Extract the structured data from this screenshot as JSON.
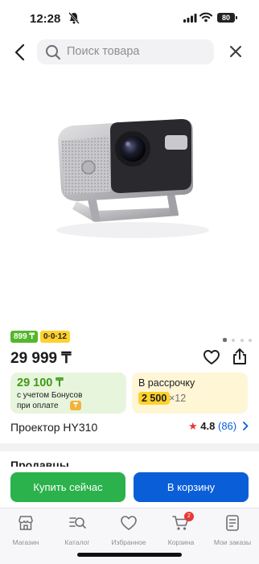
{
  "status_bar": {
    "time": "12:28",
    "battery": "80"
  },
  "search": {
    "placeholder": "Поиск товара"
  },
  "product": {
    "badge_price": "899 ₸",
    "badge_installment": "0·0·12",
    "price": "29 999 ₸",
    "title": "Проектор HY310",
    "rating": "4.8",
    "reviews": "(86)",
    "gallery_total": 4,
    "gallery_current": 1
  },
  "bonus_card": {
    "amount": "29 100 ₸",
    "line1": "с учетом Бонусов",
    "line2": "при оплате"
  },
  "installment_card": {
    "title": "В рассрочку",
    "amount": "2 500",
    "multiplier": "×12"
  },
  "sellers": {
    "title": "Продавцы"
  },
  "actions": {
    "buy_now": "Купить сейчас",
    "add_to_cart": "В корзину"
  },
  "tabs": [
    {
      "label": "Магазин",
      "icon": "shop-icon"
    },
    {
      "label": "Каталог",
      "icon": "catalog-search-icon"
    },
    {
      "label": "Избранное",
      "icon": "heart-icon"
    },
    {
      "label": "Корзина",
      "icon": "cart-icon",
      "badge": "2"
    },
    {
      "label": "Мои заказы",
      "icon": "orders-icon"
    }
  ],
  "colors": {
    "green": "#2bb24c",
    "blue": "#0a5fd8",
    "yellow": "#ffd12a",
    "red": "#e53935"
  }
}
